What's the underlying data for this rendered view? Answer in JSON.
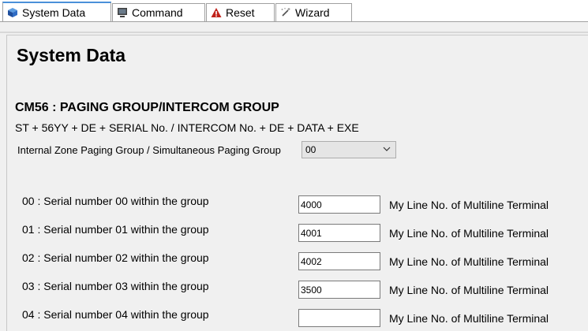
{
  "tabs": [
    {
      "label": "System Data",
      "icon": "cube-icon",
      "active": true
    },
    {
      "label": "Command",
      "icon": "monitor-icon",
      "active": false
    },
    {
      "label": "Reset",
      "icon": "warning-icon",
      "active": false
    },
    {
      "label": "Wizard",
      "icon": "magic-wand-icon",
      "active": false
    }
  ],
  "page": {
    "title": "System Data",
    "command_title": "CM56 : PAGING GROUP/INTERCOM GROUP",
    "formula": "ST + 56YY + DE + SERIAL No. / INTERCOM No. + DE + DATA + EXE",
    "group_label": "Internal Zone Paging Group / Simultaneous Paging Group",
    "group_select": {
      "value": "00"
    }
  },
  "rows": [
    {
      "label": "00 : Serial number 00 within the group",
      "value": "4000",
      "desc": "My Line No. of Multiline Terminal"
    },
    {
      "label": "01 : Serial number 01 within the group",
      "value": "4001",
      "desc": "My Line No. of Multiline Terminal"
    },
    {
      "label": "02 : Serial number 02 within the group",
      "value": "4002",
      "desc": "My Line No. of Multiline Terminal"
    },
    {
      "label": "03 : Serial number 03 within the group",
      "value": "3500",
      "desc": "My Line No. of Multiline Terminal"
    },
    {
      "label": "04 : Serial number 04 within the group",
      "value": "",
      "desc": "My Line No. of Multiline Terminal"
    }
  ]
}
